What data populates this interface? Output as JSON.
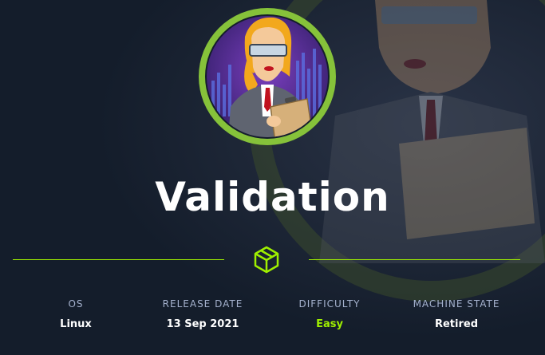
{
  "machine": {
    "name": "Validation"
  },
  "stats": [
    {
      "label": "OS",
      "value": "Linux"
    },
    {
      "label": "RELEASE DATE",
      "value": "13 Sep 2021"
    },
    {
      "label": "DIFFICULTY",
      "value": "Easy"
    },
    {
      "label": "MACHINE STATE",
      "value": "Retired"
    }
  ],
  "colors": {
    "background": "#141d2b",
    "accent_green": "#9fef00",
    "label_gray": "#a4b1cd",
    "avatar_ring": "#86c23a"
  },
  "icons": {
    "divider": "cube-icon"
  }
}
